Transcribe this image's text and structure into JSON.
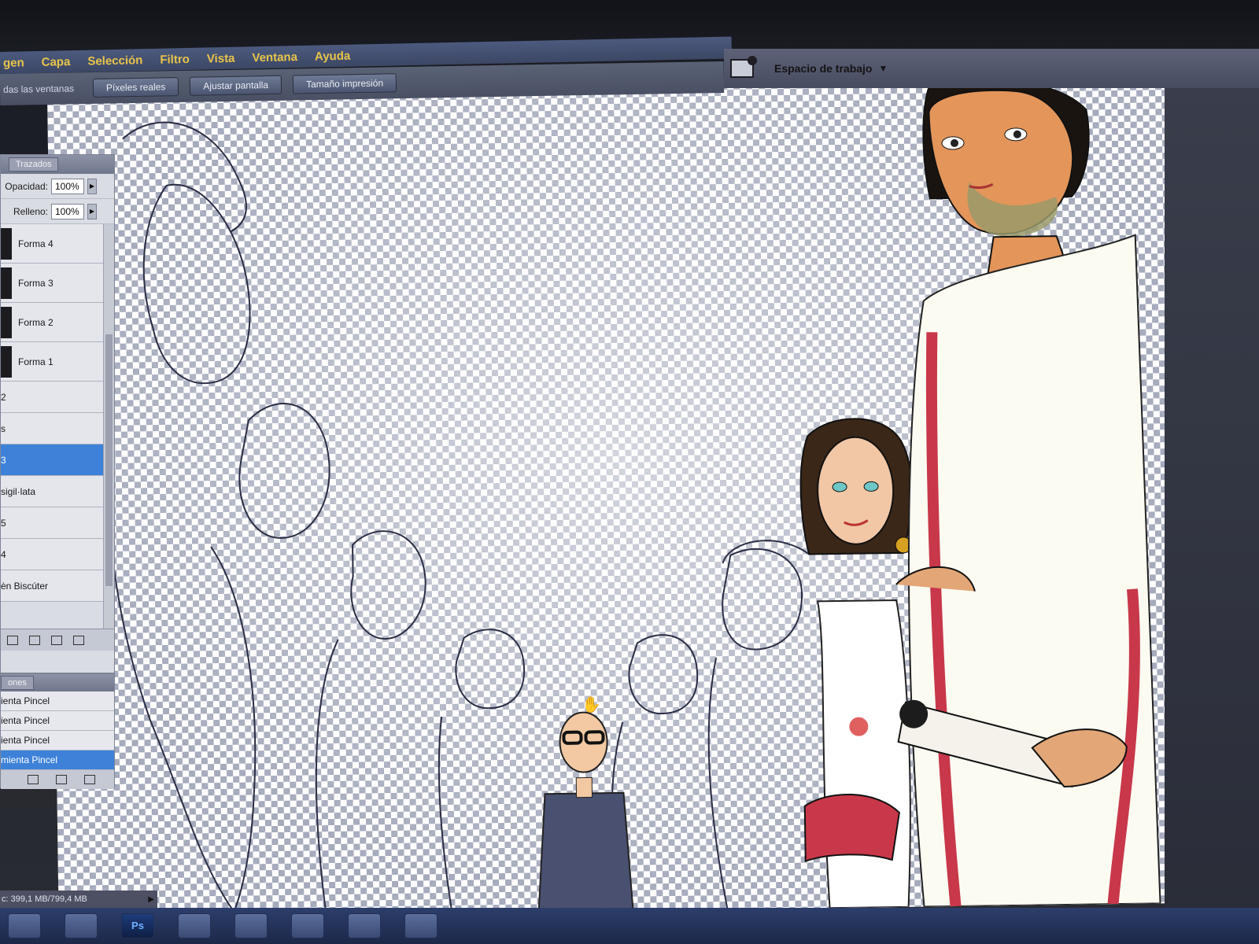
{
  "menu": {
    "items": [
      "gen",
      "Capa",
      "Selección",
      "Filtro",
      "Vista",
      "Ventana",
      "Ayuda"
    ]
  },
  "options_bar": {
    "partial_label": "das las ventanas",
    "buttons": [
      "Píxeles reales",
      "Ajustar pantalla",
      "Tamaño impresión"
    ]
  },
  "workspace": {
    "label": "Espacio de trabajo",
    "icon": "camera-icon"
  },
  "layers_panel": {
    "tab_label": "Trazados",
    "opacity_label": "Opacidad:",
    "opacity_value": "100%",
    "fill_label": "Relleno:",
    "fill_value": "100%",
    "layers": [
      {
        "name": "Forma 4",
        "selected": false
      },
      {
        "name": "Forma 3",
        "selected": false
      },
      {
        "name": "Forma 2",
        "selected": false
      },
      {
        "name": "Forma 1",
        "selected": false
      },
      {
        "name": "2",
        "selected": false
      },
      {
        "name": "s",
        "selected": false
      },
      {
        "name": "3",
        "selected": true
      },
      {
        "name": "sigil·lata",
        "selected": false
      },
      {
        "name": "5",
        "selected": false
      },
      {
        "name": "4",
        "selected": false
      },
      {
        "name": "èn Biscúter",
        "selected": false
      }
    ]
  },
  "history_panel": {
    "tab_label": "ones",
    "entries": [
      {
        "name": "ienta Pincel",
        "selected": false
      },
      {
        "name": "ienta Pincel",
        "selected": false
      },
      {
        "name": "ienta Pincel",
        "selected": false
      },
      {
        "name": "mienta Pincel",
        "selected": true
      }
    ]
  },
  "status": {
    "text": "c: 399,1 MB/799,4 MB"
  },
  "taskbar": {
    "ps_label": "Ps"
  },
  "colors": {
    "accent_menu": "#e8c54a",
    "selection": "#3d82d8",
    "checker": "#9aa0b4"
  }
}
